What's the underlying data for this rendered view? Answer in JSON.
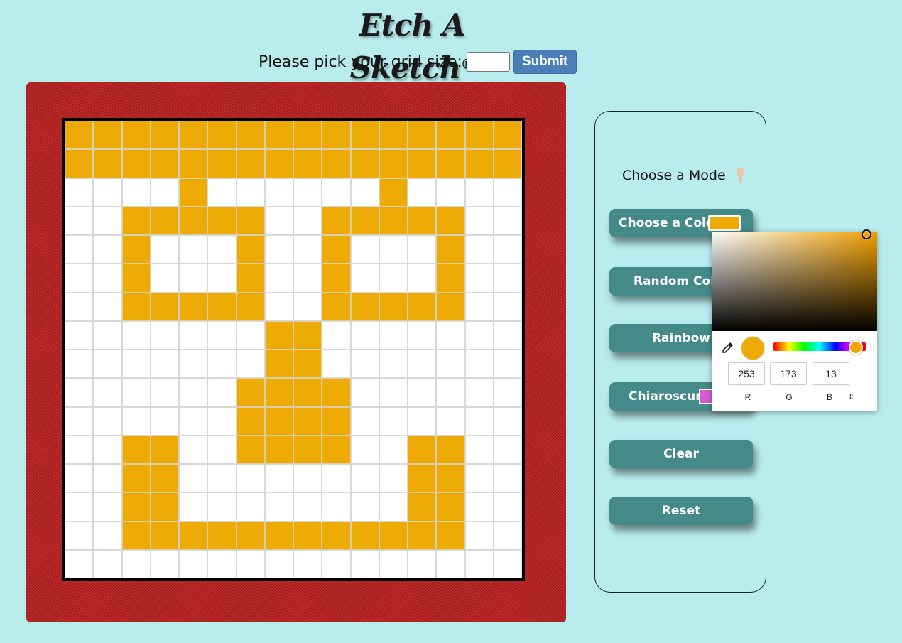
{
  "header": {
    "title": "Etch A Sketch",
    "registered_mark": "®",
    "gridsize_label": "Please pick your grid size:",
    "gridsize_value": "",
    "submit_label": "Submit"
  },
  "sketch": {
    "grid_size": 16,
    "frame_color": "#c82a2a",
    "paint_color": "#eeab05",
    "cell_color": "#ffffff",
    "painted_rows": [
      "1111111111111111",
      "1111111111111111",
      "0000100000010000",
      "0011111001111100",
      "0010001001000100",
      "0010001001000100",
      "0011111001111100",
      "0000000110000000",
      "0000000110000000",
      "0000001111000000",
      "0000001111000000",
      "0011001111001100",
      "0011000000001100",
      "0011000000001100",
      "0011111111111100",
      "0000000000000000"
    ]
  },
  "panel": {
    "mode_title": "Choose a Mode",
    "hand_icon": "pointing-down-hand-icon",
    "buttons": [
      {
        "label": "Choose a Color",
        "swatch": "#eeab05"
      },
      {
        "label": "Random Color"
      },
      {
        "label": "Rainbow"
      },
      {
        "label": "Chiaroscuro",
        "swatch": "#d35bd6"
      },
      {
        "label": "Clear"
      },
      {
        "label": "Reset"
      }
    ]
  },
  "color_picker": {
    "hue_color": "#f2a000",
    "preview_color": "#eeab05",
    "r": "253",
    "g": "173",
    "b": "13",
    "r_label": "R",
    "g_label": "G",
    "b_label": "B",
    "eyedropper_icon": "eyedropper-icon",
    "toggle_icon": "up-down-arrows-icon"
  }
}
